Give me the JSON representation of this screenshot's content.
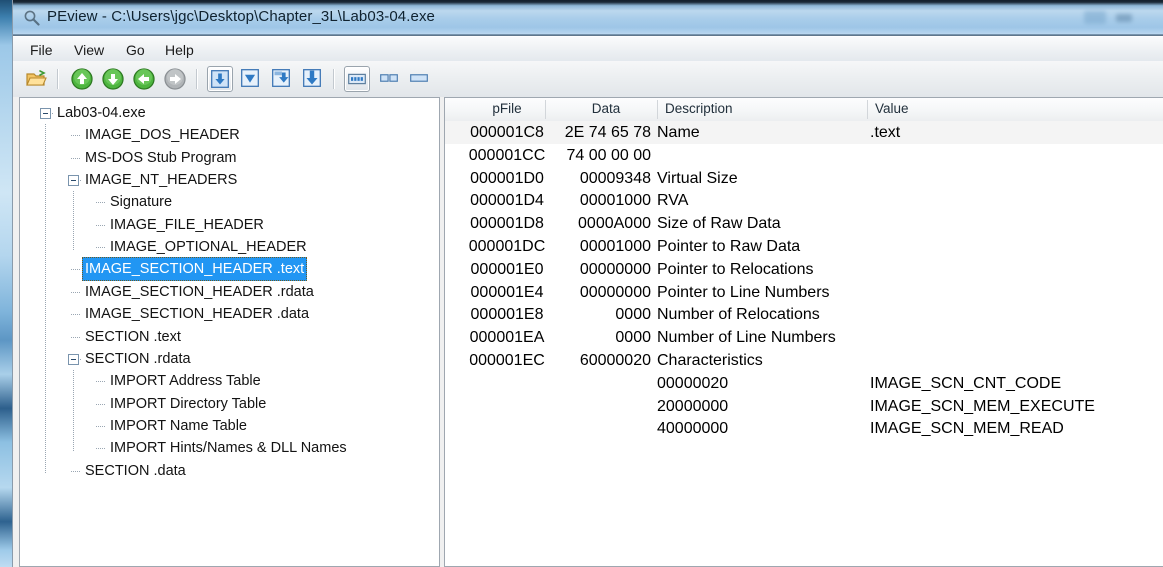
{
  "window": {
    "title": "PEview - C:\\Users\\jgc\\Desktop\\Chapter_3L\\Lab03-04.exe",
    "app_icon": "magnifier-icon"
  },
  "menu": {
    "items": [
      {
        "label": "File"
      },
      {
        "label": "View"
      },
      {
        "label": "Go"
      },
      {
        "label": "Help"
      }
    ]
  },
  "toolbar": {
    "buttons": [
      {
        "name": "open-file-button",
        "icon": "open-folder-icon",
        "pressed": false
      },
      {
        "name": "nav-up-button",
        "icon": "arrow-up-green-icon",
        "pressed": false
      },
      {
        "name": "nav-down-button",
        "icon": "arrow-down-green-icon",
        "pressed": false
      },
      {
        "name": "nav-back-button",
        "icon": "arrow-back-green-icon",
        "pressed": false
      },
      {
        "name": "nav-forward-button",
        "icon": "arrow-forward-gray-icon",
        "pressed": false
      },
      {
        "name": "view-hex-dump-button",
        "icon": "blue-down-box-icon",
        "pressed": true
      },
      {
        "name": "view-structures-button",
        "icon": "blue-triangle-icon",
        "pressed": false
      },
      {
        "name": "view-section-button",
        "icon": "blue-down-small-icon",
        "pressed": false
      },
      {
        "name": "view-full-button",
        "icon": "blue-down-large-icon",
        "pressed": false
      },
      {
        "name": "show-toolbar-button",
        "icon": "keyboard-icon",
        "pressed": true
      },
      {
        "name": "split-view-button",
        "icon": "two-pane-icon",
        "pressed": false
      },
      {
        "name": "single-view-button",
        "icon": "one-pane-icon",
        "pressed": false
      }
    ]
  },
  "tree": {
    "nodes": [
      {
        "label": "Lab03-04.exe",
        "depth": 0,
        "expander": "minus",
        "selected": false
      },
      {
        "label": "IMAGE_DOS_HEADER",
        "depth": 1,
        "expander": "none",
        "selected": false
      },
      {
        "label": "MS-DOS Stub Program",
        "depth": 1,
        "expander": "none",
        "selected": false
      },
      {
        "label": "IMAGE_NT_HEADERS",
        "depth": 1,
        "expander": "minus",
        "selected": false
      },
      {
        "label": "Signature",
        "depth": 2,
        "expander": "none",
        "selected": false
      },
      {
        "label": "IMAGE_FILE_HEADER",
        "depth": 2,
        "expander": "none",
        "selected": false
      },
      {
        "label": "IMAGE_OPTIONAL_HEADER",
        "depth": 2,
        "expander": "none",
        "selected": false
      },
      {
        "label": "IMAGE_SECTION_HEADER .text",
        "depth": 1,
        "expander": "none",
        "selected": true
      },
      {
        "label": "IMAGE_SECTION_HEADER .rdata",
        "depth": 1,
        "expander": "none",
        "selected": false
      },
      {
        "label": "IMAGE_SECTION_HEADER .data",
        "depth": 1,
        "expander": "none",
        "selected": false
      },
      {
        "label": "SECTION .text",
        "depth": 1,
        "expander": "none",
        "selected": false
      },
      {
        "label": "SECTION .rdata",
        "depth": 1,
        "expander": "minus",
        "selected": false
      },
      {
        "label": "IMPORT Address Table",
        "depth": 2,
        "expander": "none",
        "selected": false
      },
      {
        "label": "IMPORT Directory Table",
        "depth": 2,
        "expander": "none",
        "selected": false
      },
      {
        "label": "IMPORT Name Table",
        "depth": 2,
        "expander": "none",
        "selected": false
      },
      {
        "label": "IMPORT Hints/Names & DLL Names",
        "depth": 2,
        "expander": "none",
        "selected": false
      },
      {
        "label": "SECTION .data",
        "depth": 1,
        "expander": "none",
        "selected": false
      }
    ]
  },
  "list": {
    "columns": [
      {
        "key": "pfile",
        "label": "pFile"
      },
      {
        "key": "data",
        "label": "Data"
      },
      {
        "key": "desc",
        "label": "Description"
      },
      {
        "key": "value",
        "label": "Value"
      }
    ],
    "rows": [
      {
        "pfile": "000001C8",
        "data": "2E 74 65 78",
        "desc": "Name",
        "value": ".text",
        "highlighted": true
      },
      {
        "pfile": "000001CC",
        "data": "74 00 00 00",
        "desc": "",
        "value": "",
        "highlighted": false
      },
      {
        "pfile": "000001D0",
        "data": "00009348",
        "desc": "Virtual Size",
        "value": "",
        "highlighted": false
      },
      {
        "pfile": "000001D4",
        "data": "00001000",
        "desc": "RVA",
        "value": "",
        "highlighted": false
      },
      {
        "pfile": "000001D8",
        "data": "0000A000",
        "desc": "Size of Raw Data",
        "value": "",
        "highlighted": false
      },
      {
        "pfile": "000001DC",
        "data": "00001000",
        "desc": "Pointer to Raw Data",
        "value": "",
        "highlighted": false
      },
      {
        "pfile": "000001E0",
        "data": "00000000",
        "desc": "Pointer to Relocations",
        "value": "",
        "highlighted": false
      },
      {
        "pfile": "000001E4",
        "data": "00000000",
        "desc": "Pointer to Line Numbers",
        "value": "",
        "highlighted": false
      },
      {
        "pfile": "000001E8",
        "data": "0000",
        "desc": "Number of Relocations",
        "value": "",
        "highlighted": false
      },
      {
        "pfile": "000001EA",
        "data": "0000",
        "desc": "Number of Line Numbers",
        "value": "",
        "highlighted": false
      },
      {
        "pfile": "000001EC",
        "data": "60000020",
        "desc": "Characteristics",
        "value": "",
        "highlighted": false
      },
      {
        "pfile": "",
        "data": "",
        "desc": "00000020",
        "value": "IMAGE_SCN_CNT_CODE",
        "highlighted": false
      },
      {
        "pfile": "",
        "data": "",
        "desc": "20000000",
        "value": "IMAGE_SCN_MEM_EXECUTE",
        "highlighted": false
      },
      {
        "pfile": "",
        "data": "",
        "desc": "40000000",
        "value": "IMAGE_SCN_MEM_READ",
        "highlighted": false
      }
    ]
  },
  "colors": {
    "selection_blue": "#2196f3",
    "titlebar_blue": "#a9cdea",
    "row_highlight": "#f4f4f4",
    "pane_border": "#9fa7b0"
  }
}
